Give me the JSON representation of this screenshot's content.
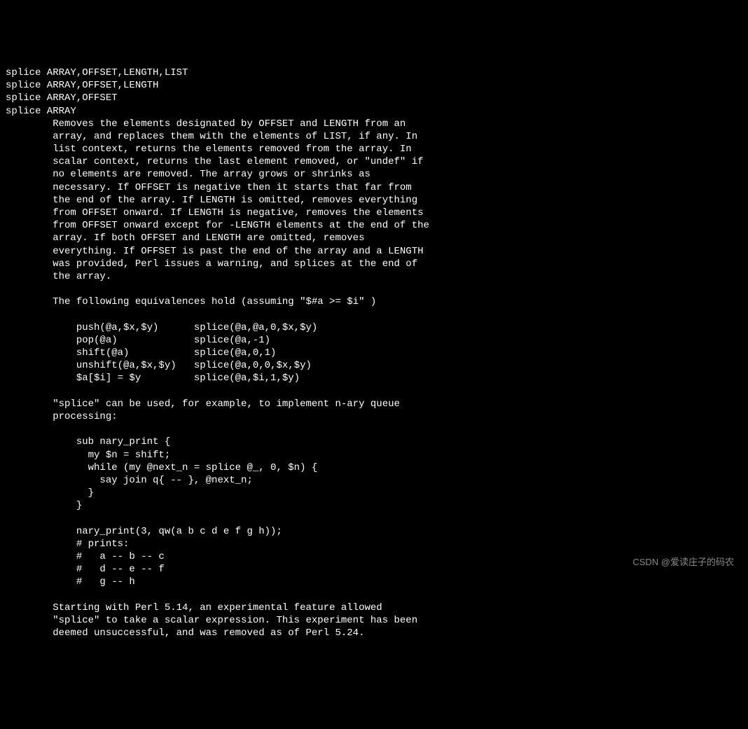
{
  "synopsis": {
    "line1": "splice ARRAY,OFFSET,LENGTH,LIST",
    "line2": "splice ARRAY,OFFSET,LENGTH",
    "line3": "splice ARRAY,OFFSET",
    "line4": "splice ARRAY"
  },
  "description": {
    "para1_l1": "        Removes the elements designated by OFFSET and LENGTH from an",
    "para1_l2": "        array, and replaces them with the elements of LIST, if any. In",
    "para1_l3": "        list context, returns the elements removed from the array. In",
    "para1_l4": "        scalar context, returns the last element removed, or \"undef\" if",
    "para1_l5": "        no elements are removed. The array grows or shrinks as",
    "para1_l6": "        necessary. If OFFSET is negative then it starts that far from",
    "para1_l7": "        the end of the array. If LENGTH is omitted, removes everything",
    "para1_l8": "        from OFFSET onward. If LENGTH is negative, removes the elements",
    "para1_l9": "        from OFFSET onward except for -LENGTH elements at the end of the",
    "para1_l10": "        array. If both OFFSET and LENGTH are omitted, removes",
    "para1_l11": "        everything. If OFFSET is past the end of the array and a LENGTH",
    "para1_l12": "        was provided, Perl issues a warning, and splices at the end of",
    "para1_l13": "        the array."
  },
  "equivalences": {
    "intro": "        The following equivalences hold (assuming \"$#a >= $i\" )",
    "row1": "            push(@a,$x,$y)      splice(@a,@a,0,$x,$y)",
    "row2": "            pop(@a)             splice(@a,-1)",
    "row3": "            shift(@a)           splice(@a,0,1)",
    "row4": "            unshift(@a,$x,$y)   splice(@a,0,0,$x,$y)",
    "row5": "            $a[$i] = $y         splice(@a,$i,1,$y)"
  },
  "example": {
    "intro_l1": "        \"splice\" can be used, for example, to implement n-ary queue",
    "intro_l2": "        processing:",
    "code_l1": "            sub nary_print {",
    "code_l2": "              my $n = shift;",
    "code_l3": "              while (my @next_n = splice @_, 0, $n) {",
    "code_l4": "                say join q{ -- }, @next_n;",
    "code_l5": "              }",
    "code_l6": "            }",
    "code_l7": "            nary_print(3, qw(a b c d e f g h));",
    "code_l8": "            # prints:",
    "code_l9": "            #   a -- b -- c",
    "code_l10": "            #   d -- e -- f",
    "code_l11": "            #   g -- h"
  },
  "footer": {
    "l1": "        Starting with Perl 5.14, an experimental feature allowed",
    "l2": "        \"splice\" to take a scalar expression. This experiment has been",
    "l3": "        deemed unsuccessful, and was removed as of Perl 5.24."
  },
  "watermark": "CSDN @爱读庄子的码农"
}
